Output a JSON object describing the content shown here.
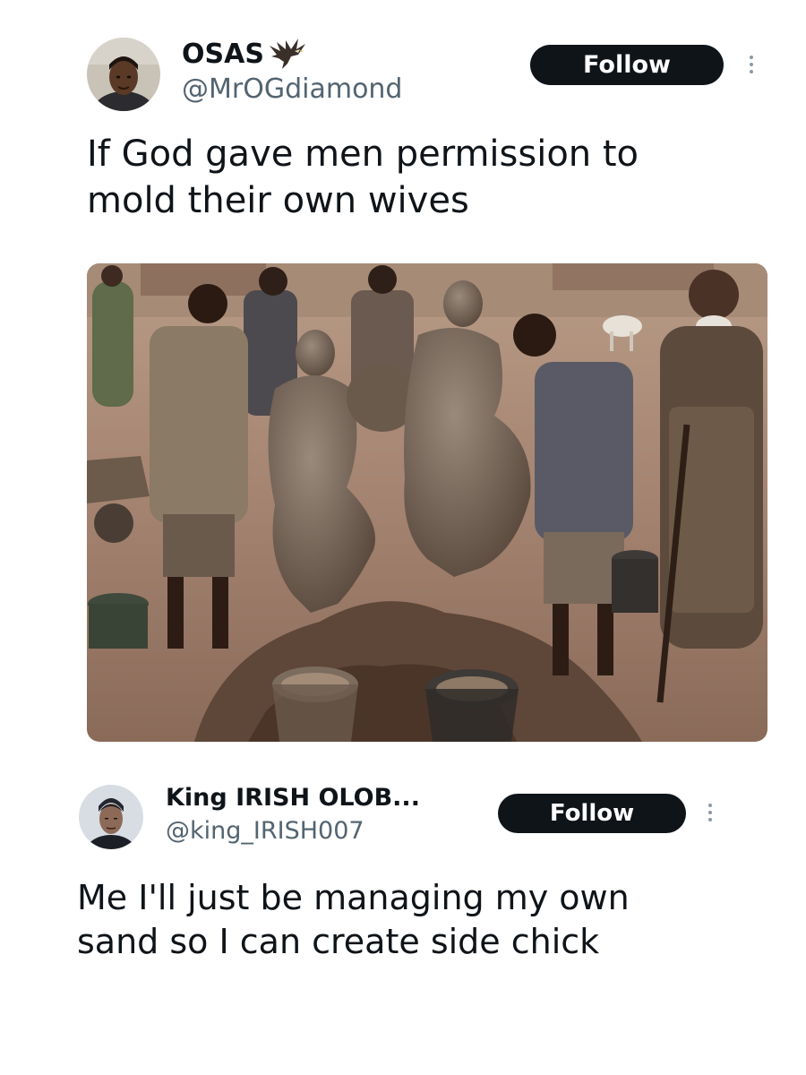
{
  "tweets": [
    {
      "display_name": "OSAS",
      "emoji_name": "eagle-emoji",
      "handle": "@MrOGdiamond",
      "follow_label": "Follow",
      "text": "If God gave men permission to mold their own wives",
      "media": {
        "kind": "photo",
        "icon": "photo-media"
      }
    },
    {
      "display_name": "King IRISH OLOB...",
      "handle": "@king_IRISH007",
      "follow_label": "Follow",
      "text": "Me I'll just be managing my own sand so I can create side chick"
    }
  ],
  "colors": {
    "follow_bg": "#0f1419",
    "follow_text": "#ffffff",
    "handle": "#536471",
    "text": "#0f1419",
    "more_dots": "#8b98a5"
  }
}
